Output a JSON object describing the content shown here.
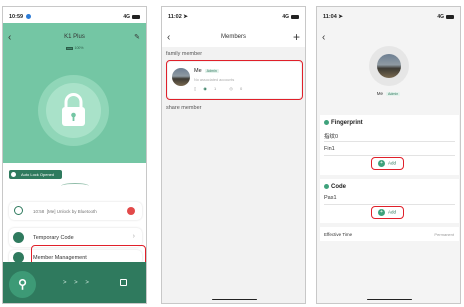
{
  "screen1": {
    "time": "10:59",
    "signal": "4G",
    "title": "K1 Plus",
    "battery_pct": "100%",
    "auto_lock": "Auto Lock Opened",
    "log_time": "10:58",
    "log_text": "[Me] Unlock by Bluetooth",
    "menu": [
      {
        "label": "Temporary Code"
      },
      {
        "label": "Member Management"
      }
    ],
    "bottom_arrows": "> > >"
  },
  "screen2": {
    "time": "11:02",
    "signal": "4G",
    "title": "Members",
    "family_label": "family member",
    "member": {
      "name": "Me",
      "badge": "Admin",
      "note": "No associated accounts",
      "count_a": "1",
      "count_b": "0"
    },
    "share_label": "share member"
  },
  "screen3": {
    "time": "11:04",
    "signal": "4G",
    "name": "Me",
    "badge": "Admin",
    "fingerprint_title": "Fingerprint",
    "fingerprints": [
      "指纹0",
      "Fin1"
    ],
    "add_label": "Add",
    "code_title": "Code",
    "codes": [
      "Pas1"
    ],
    "effective_label": "Effective Time",
    "effective_value": "Permanent"
  },
  "colors": {
    "accent": "#2f7a5e",
    "hero": "#74c6a4",
    "highlight": "#e0202a"
  }
}
